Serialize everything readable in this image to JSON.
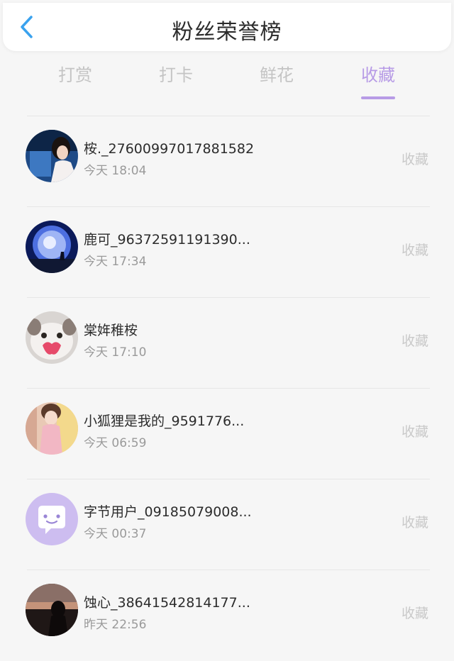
{
  "header": {
    "title": "粉丝荣誉榜",
    "back_icon": "chevron-left-icon"
  },
  "colors": {
    "accent": "#b79be6",
    "back": "#3aa2ee"
  },
  "tabs": [
    {
      "label": "打赏",
      "active": false
    },
    {
      "label": "打卡",
      "active": false
    },
    {
      "label": "鲜花",
      "active": false
    },
    {
      "label": "收藏",
      "active": true
    }
  ],
  "fans": [
    {
      "name": "桉._27600997017881582",
      "time": "今天 18:04",
      "action": "收藏"
    },
    {
      "name": "鹿可_96372591191390...",
      "time": "今天 17:34",
      "action": "收藏"
    },
    {
      "name": "棠姩稚桉",
      "time": "今天 17:10",
      "action": "收藏"
    },
    {
      "name": "小狐狸是我的_9591776...",
      "time": "今天 06:59",
      "action": "收藏"
    },
    {
      "name": "字节用户_09185079008...",
      "time": "今天 00:37",
      "action": "收藏"
    },
    {
      "name": "蚀心_38641542814177...",
      "time": "昨天 22:56",
      "action": "收藏"
    }
  ]
}
